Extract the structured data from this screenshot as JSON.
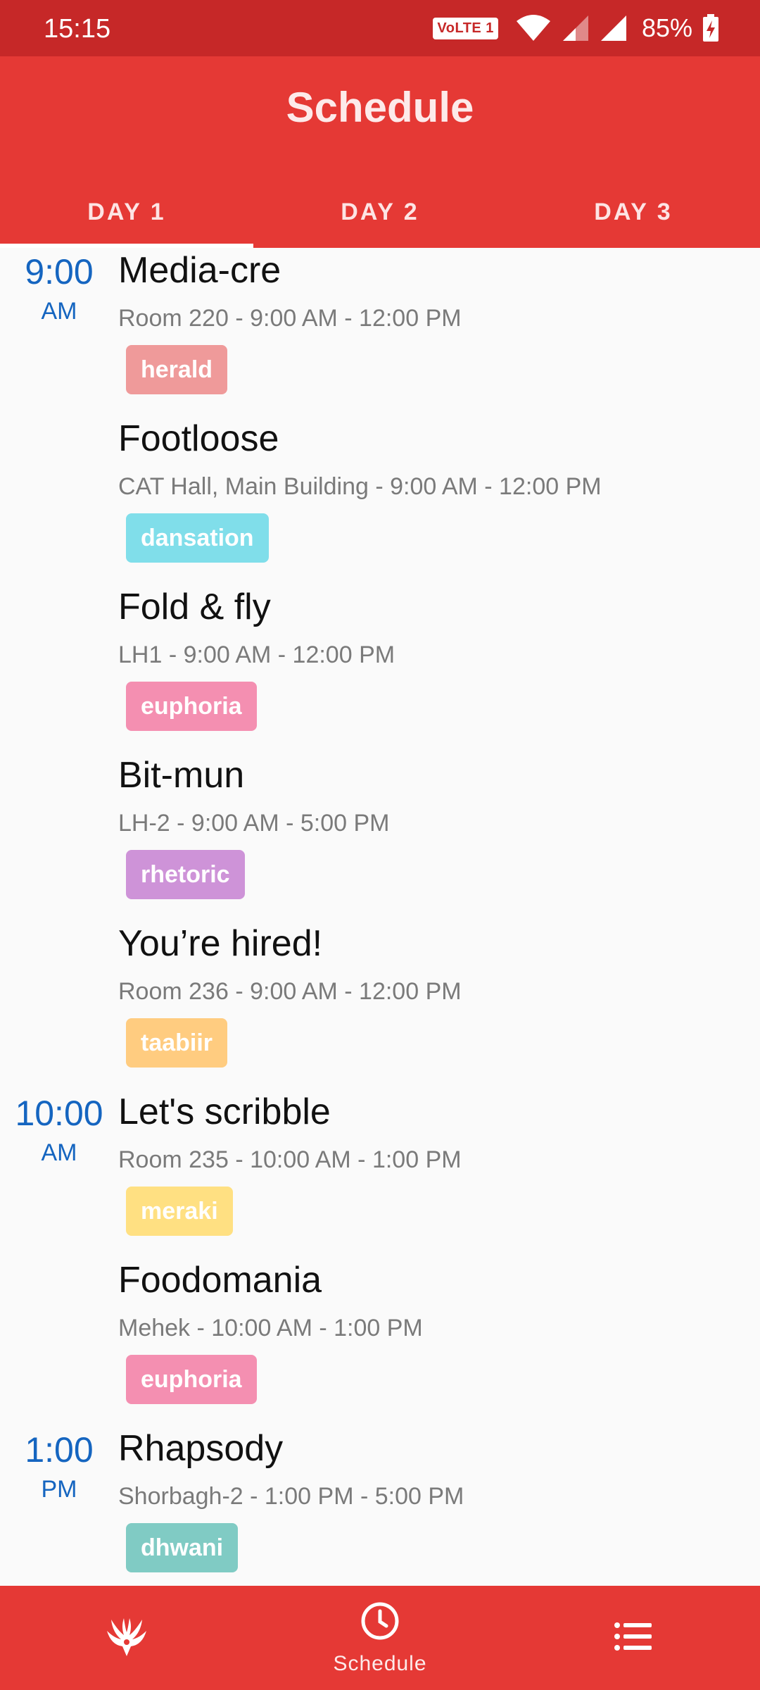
{
  "status_bar": {
    "time": "15:15",
    "network_badge": "VoLTE 1",
    "battery": "85%"
  },
  "header": {
    "title": "Schedule"
  },
  "tabs": [
    {
      "label": "DAY 1",
      "active": true
    },
    {
      "label": "DAY 2",
      "active": false
    },
    {
      "label": "DAY 3",
      "active": false
    }
  ],
  "events": [
    {
      "time": "9:00",
      "ampm": "AM",
      "title": "Media-cre",
      "subtitle": "Room 220 - 9:00 AM - 12:00 PM",
      "tag": "herald",
      "tag_color": "#ef9a9a"
    },
    {
      "time": "",
      "ampm": "",
      "title": "Footloose",
      "subtitle": "CAT Hall, Main Building - 9:00 AM - 12:00 PM",
      "tag": "dansation",
      "tag_color": "#80deea"
    },
    {
      "time": "",
      "ampm": "",
      "title": "Fold & fly",
      "subtitle": "LH1 - 9:00 AM - 12:00 PM",
      "tag": "euphoria",
      "tag_color": "#f48fb1"
    },
    {
      "time": "",
      "ampm": "",
      "title": "Bit-mun",
      "subtitle": "LH-2 - 9:00 AM - 5:00 PM",
      "tag": "rhetoric",
      "tag_color": "#ce93d8"
    },
    {
      "time": "",
      "ampm": "",
      "title": "You’re hired!",
      "subtitle": "Room 236 - 9:00 AM - 12:00 PM",
      "tag": "taabiir",
      "tag_color": "#ffcc80"
    },
    {
      "time": "10:00",
      "ampm": "AM",
      "title": "Let's scribble",
      "subtitle": "Room 235 - 10:00 AM - 1:00 PM",
      "tag": "meraki",
      "tag_color": "#ffe082"
    },
    {
      "time": "",
      "ampm": "",
      "title": "Foodomania",
      "subtitle": "Mehek - 10:00 AM - 1:00 PM",
      "tag": "euphoria",
      "tag_color": "#f48fb1"
    },
    {
      "time": "1:00",
      "ampm": "PM",
      "title": "Rhapsody",
      "subtitle": "Shorbagh-2 - 1:00 PM - 5:00 PM",
      "tag": "dhwani",
      "tag_color": "#80cbc4"
    }
  ],
  "bottom_nav": {
    "logo_icon": "phoenix-logo-icon",
    "schedule_label": "Schedule",
    "schedule_icon": "clock-icon",
    "list_icon": "list-icon"
  },
  "colors": {
    "primary": "#e53935",
    "status_bar": "#c62828",
    "time_accent": "#1565c0"
  }
}
